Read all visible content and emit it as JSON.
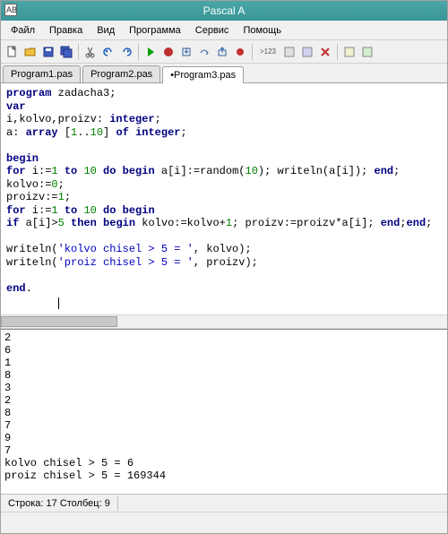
{
  "title": "Pascal A",
  "menu": {
    "file": "Файл",
    "edit": "Правка",
    "view": "Вид",
    "program": "Программа",
    "service": "Сервис",
    "help": "Помощь"
  },
  "tabs": {
    "t1": "Program1.pas",
    "t2": "Program2.pas",
    "t3": "•Program3.pas"
  },
  "code": {
    "l1a": "program",
    "l1b": " zadacha3;",
    "l2": "var",
    "l3a": "i,kolvo,proizv: ",
    "l3b": "integer",
    "l3c": ";",
    "l4a": "a: ",
    "l4b": "array",
    "l4c": " [",
    "l4d": "1",
    "l4e": "..",
    "l4f": "10",
    "l4g": "] ",
    "l4h": "of",
    "l4i": " ",
    "l4j": "integer",
    "l4k": ";",
    "l6": "begin",
    "l7a": "for",
    "l7b": " i:=",
    "l7c": "1",
    "l7d": " ",
    "l7e": "to",
    "l7f": " ",
    "l7g": "10",
    "l7h": " ",
    "l7i": "do",
    "l7j": " ",
    "l7k": "begin",
    "l7l": " a[i]:=random(",
    "l7m": "10",
    "l7n": "); writeln(a[i]); ",
    "l7o": "end",
    "l7p": ";",
    "l8a": "kolvo:=",
    "l8b": "0",
    "l8c": ";",
    "l9a": "proizv:=",
    "l9b": "1",
    "l9c": ";",
    "l10a": "for",
    "l10b": " i:=",
    "l10c": "1",
    "l10d": " ",
    "l10e": "to",
    "l10f": " ",
    "l10g": "10",
    "l10h": " ",
    "l10i": "do",
    "l10j": " ",
    "l10k": "begin",
    "l11a": "if",
    "l11b": " a[i]>",
    "l11c": "5",
    "l11d": " ",
    "l11e": "then",
    "l11f": " ",
    "l11g": "begin",
    "l11h": " kolvo:=kolvo+",
    "l11i": "1",
    "l11j": "; proizv:=proizv*a[i]; ",
    "l11k": "end",
    "l11l": ";",
    "l11m": "end",
    "l11n": ";",
    "l13a": "writeln(",
    "l13b": "'kolvo chisel > 5 = '",
    "l13c": ", kolvo);",
    "l14a": "writeln(",
    "l14b": "'proiz chisel > 5 = '",
    "l14c": ", proizv);",
    "l16a": "end",
    "l16b": "."
  },
  "output_lines": [
    "2",
    "6",
    "1",
    "8",
    "3",
    "2",
    "8",
    "7",
    "9",
    "7",
    "kolvo chisel > 5 = 6",
    "proiz chisel > 5 = 169344"
  ],
  "status": {
    "line_label": "Строка: ",
    "line_val": "17",
    "col_label": "   Столбец: ",
    "col_val": "9"
  }
}
